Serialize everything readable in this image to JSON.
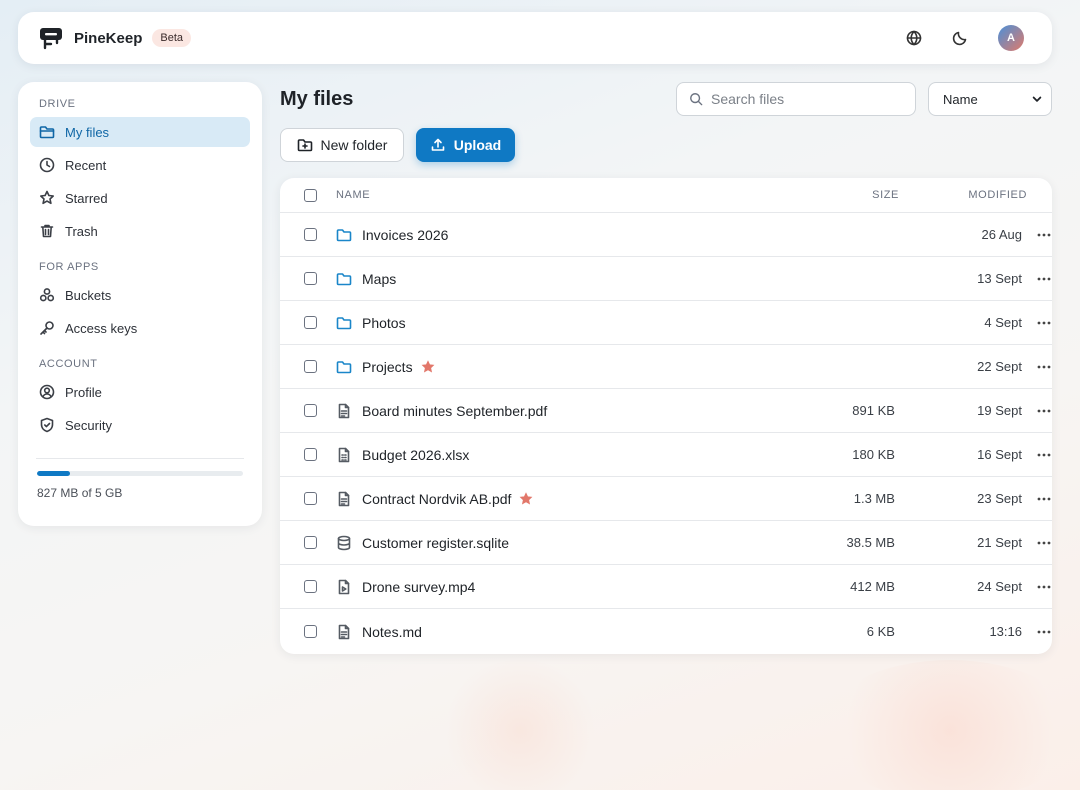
{
  "app": {
    "name": "PineKeep",
    "badge": "Beta",
    "avatar_initial": "A"
  },
  "sidebar": {
    "sections": [
      {
        "title": "DRIVE",
        "items": [
          {
            "label": "My files",
            "icon": "folder-open-icon",
            "active": true
          },
          {
            "label": "Recent",
            "icon": "clock-icon"
          },
          {
            "label": "Starred",
            "icon": "star-icon"
          },
          {
            "label": "Trash",
            "icon": "trash-icon"
          }
        ]
      },
      {
        "title": "FOR APPS",
        "items": [
          {
            "label": "Buckets",
            "icon": "buckets-icon"
          },
          {
            "label": "Access keys",
            "icon": "key-icon"
          }
        ]
      },
      {
        "title": "ACCOUNT",
        "items": [
          {
            "label": "Profile",
            "icon": "user-circle-icon"
          },
          {
            "label": "Security",
            "icon": "shield-icon"
          }
        ]
      }
    ],
    "storage": {
      "text": "827 MB of 5 GB",
      "used_fraction": 0.16
    }
  },
  "main": {
    "title": "My files",
    "search_placeholder": "Search files",
    "sort_value": "Name",
    "new_folder_label": "New folder",
    "upload_label": "Upload",
    "columns": {
      "name": "NAME",
      "size": "SIZE",
      "modified": "MODIFIED"
    },
    "files": [
      {
        "name": "Invoices 2026",
        "type": "folder",
        "size": "",
        "modified": "26 Aug",
        "starred": false
      },
      {
        "name": "Maps",
        "type": "folder",
        "size": "",
        "modified": "13 Sept",
        "starred": false
      },
      {
        "name": "Photos",
        "type": "folder",
        "size": "",
        "modified": "4 Sept",
        "starred": false
      },
      {
        "name": "Projects",
        "type": "folder",
        "size": "",
        "modified": "22 Sept",
        "starred": true
      },
      {
        "name": "Board minutes September.pdf",
        "type": "doc",
        "size": "891 KB",
        "modified": "19 Sept",
        "starred": false
      },
      {
        "name": "Budget 2026.xlsx",
        "type": "sheet",
        "size": "180 KB",
        "modified": "16 Sept",
        "starred": false
      },
      {
        "name": "Contract Nordvik AB.pdf",
        "type": "doc",
        "size": "1.3 MB",
        "modified": "23 Sept",
        "starred": true
      },
      {
        "name": "Customer register.sqlite",
        "type": "database",
        "size": "38.5 MB",
        "modified": "21 Sept",
        "starred": false
      },
      {
        "name": "Drone survey.mp4",
        "type": "video",
        "size": "412 MB",
        "modified": "24 Sept",
        "starred": false
      },
      {
        "name": "Notes.md",
        "type": "doc",
        "size": "6 KB",
        "modified": "13:16",
        "starred": false
      }
    ]
  },
  "colors": {
    "accent": "#0f79c4",
    "active_bg": "#d8eaf6",
    "star": "#e2776a",
    "folder": "#1a86c9"
  }
}
